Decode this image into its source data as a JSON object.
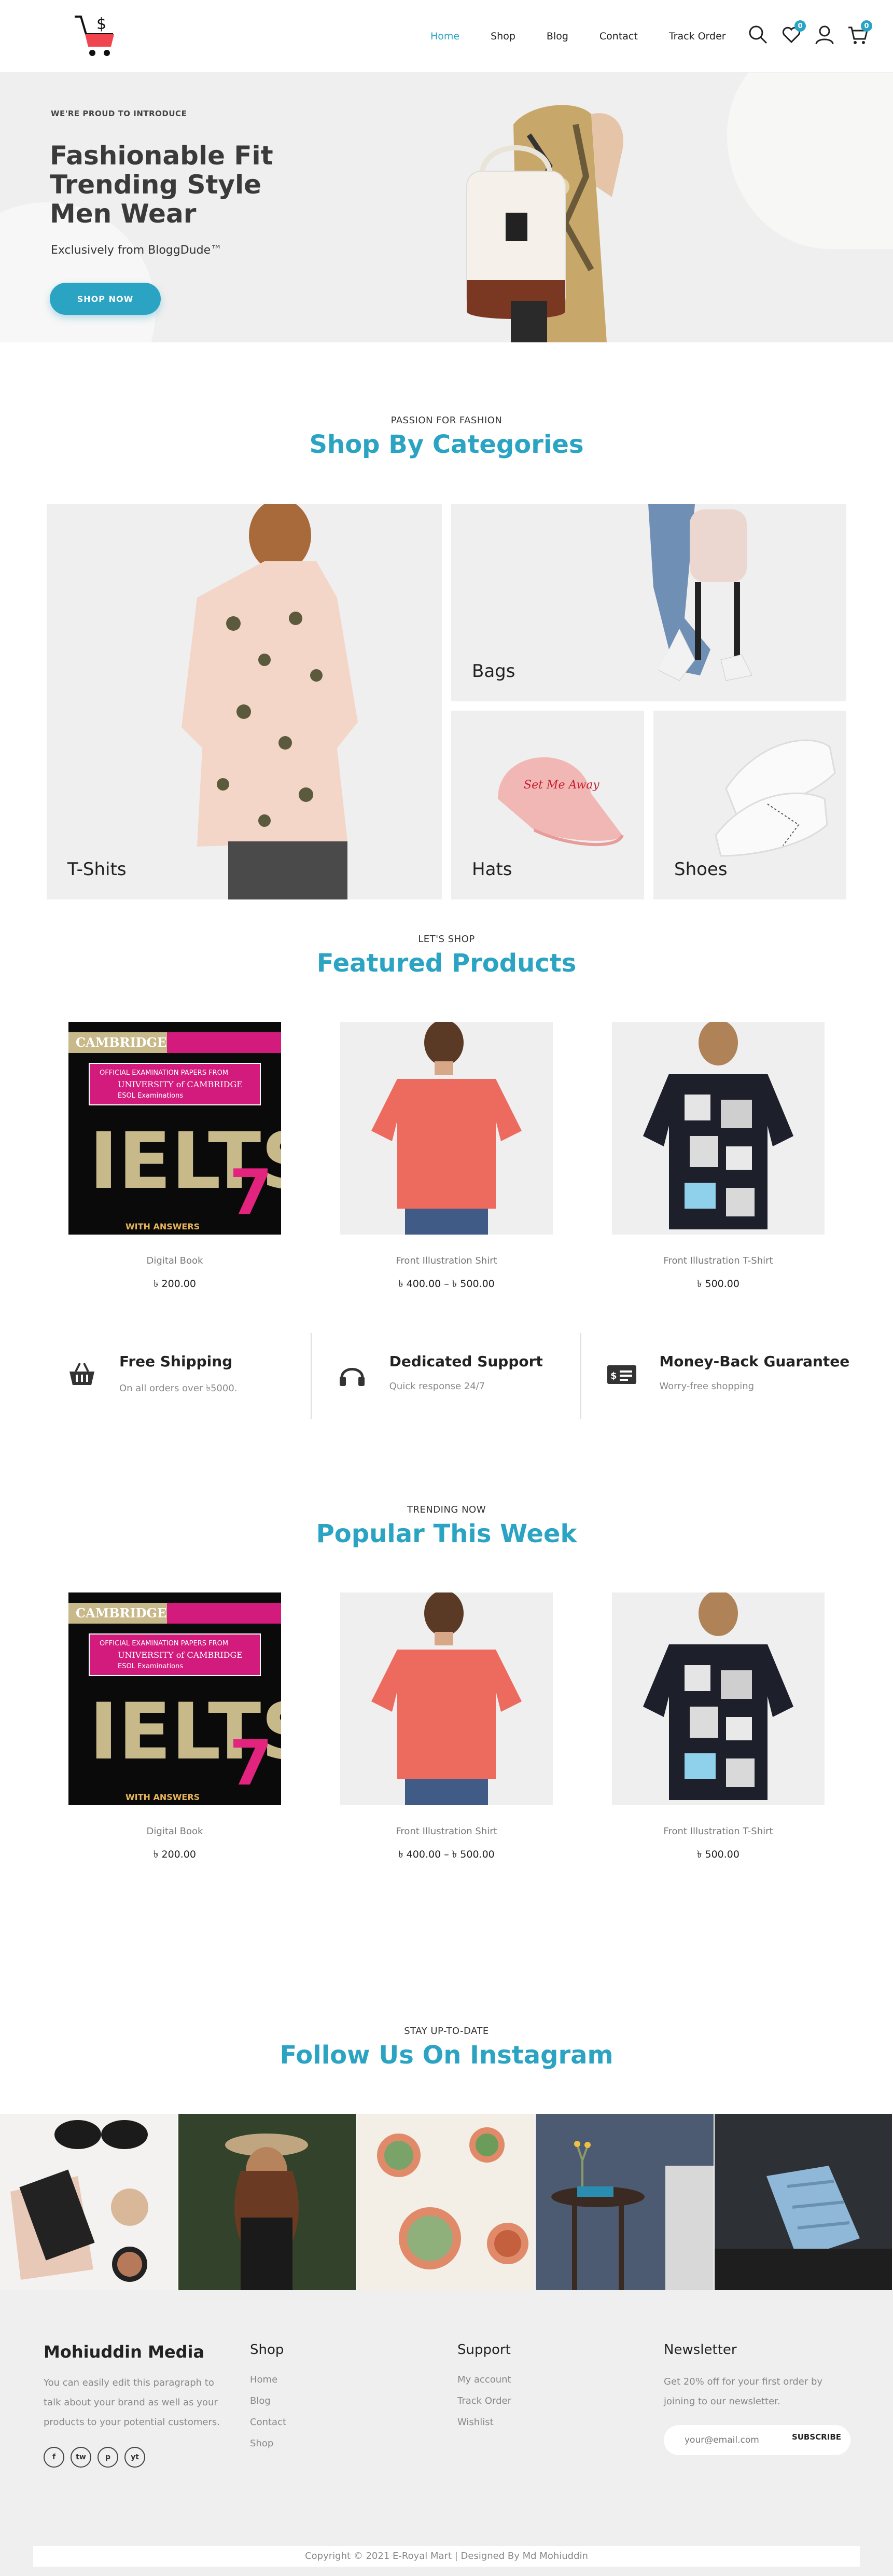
{
  "header": {
    "nav": [
      "Home",
      "Shop",
      "Blog",
      "Contact",
      "Track Order"
    ],
    "wishlist_count": "0",
    "cart_count": "0"
  },
  "hero": {
    "kicker": "WE'RE PROUD TO INTRODUCE",
    "title": "Fashionable Fit Trending Style Men Wear",
    "subtitle": "Exclusively from BloggDude™",
    "button": "SHOP NOW"
  },
  "categories": {
    "kicker": "PASSION FOR FASHION",
    "title": "Shop By Categories",
    "items": [
      "T-Shits",
      "Bags",
      "Hats",
      "Shoes"
    ]
  },
  "featured": {
    "kicker": "LET'S SHOP",
    "title": "Featured Products",
    "products": [
      {
        "name": "Digital Book",
        "price": "৳ 200.00"
      },
      {
        "name": "Front Illustration Shirt",
        "price": "৳ 400.00 – ৳ 500.00"
      },
      {
        "name": "Front Illustration T-Shirt",
        "price": "৳ 500.00"
      }
    ]
  },
  "features": [
    {
      "title": "Free Shipping",
      "sub": "On all orders over ৳5000.",
      "icon": "basket-icon"
    },
    {
      "title": "Dedicated Support",
      "sub": "Quick response 24/7",
      "icon": "headphones-icon"
    },
    {
      "title": "Money-Back Guarantee",
      "sub": "Worry-free shopping",
      "icon": "money-icon"
    }
  ],
  "popular": {
    "kicker": "TRENDING NOW",
    "title": "Popular This Week",
    "products": [
      {
        "name": "Digital Book",
        "price": "৳ 200.00"
      },
      {
        "name": "Front Illustration Shirt",
        "price": "৳ 400.00 – ৳ 500.00"
      },
      {
        "name": "Front Illustration T-Shirt",
        "price": "৳ 500.00"
      }
    ]
  },
  "instagram": {
    "kicker": "STAY UP-TO-DATE",
    "title": "Follow Us On Instagram"
  },
  "book": {
    "publisher": "CAMBRIDGE",
    "line1": "OFFICIAL EXAMINATION PAPERS FROM",
    "line2": "UNIVERSITY of CAMBRIDGE",
    "line3": "ESOL Examinations",
    "brand": "IELTS",
    "number": "7",
    "answers": "WITH ANSWERS"
  },
  "hat_text": "Set Me Away",
  "footer": {
    "brand": "Mohiuddin Media",
    "text": "You can easily edit this paragraph to talk about your brand as well as your products to your potential customers.",
    "shop_head": "Shop",
    "shop_links": [
      "Home",
      "Blog",
      "Contact",
      "Shop"
    ],
    "support_head": "Support",
    "support_links": [
      "My account",
      "Track Order",
      "Wishlist"
    ],
    "news_head": "Newsletter",
    "news_text": "Get 20% off for your first order by joining to our newsletter.",
    "email_placeholder": "your@email.com",
    "subscribe": "SUBSCRIBE",
    "social": [
      "f",
      "tw",
      "p",
      "yt"
    ],
    "copyright": "Copyright © 2021 E-Royal Mart | Designed By Md Mohiuddin"
  }
}
